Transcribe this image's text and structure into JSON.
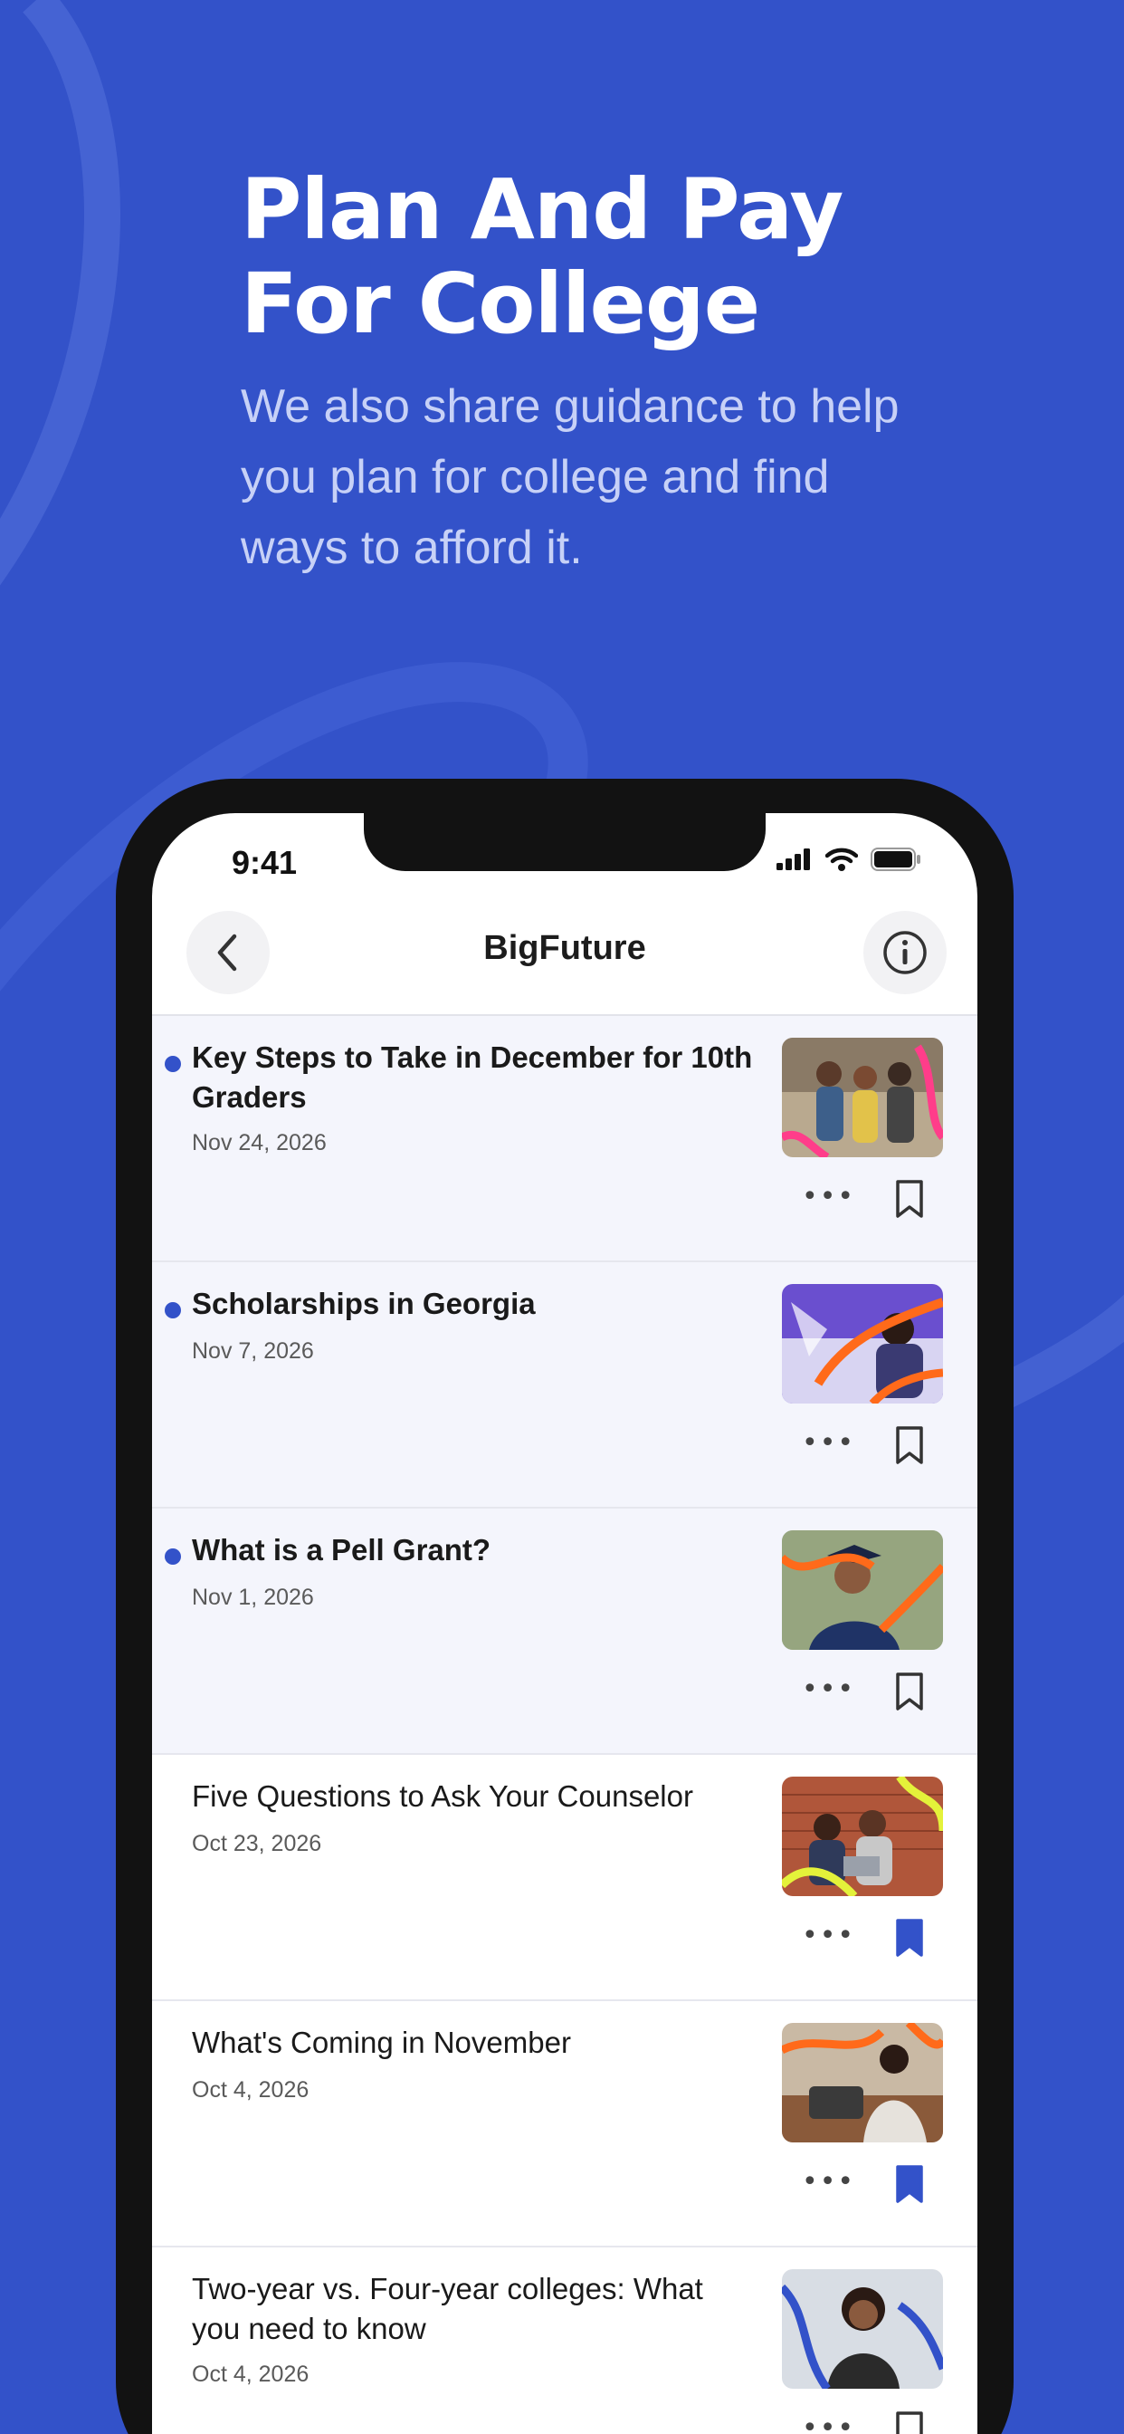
{
  "hero": {
    "title_line1": "Plan And Pay",
    "title_line2": "For College",
    "subtitle": "We also share guidance to help you plan for college and find ways to afford it."
  },
  "status_bar": {
    "time": "9:41",
    "icons": [
      "cellular-signal-icon",
      "wifi-icon",
      "battery-icon"
    ]
  },
  "nav": {
    "title": "BigFuture",
    "back_icon": "chevron-left-icon",
    "info_icon": "info-icon"
  },
  "colors": {
    "background": "#3352c9",
    "accent": "#3352c9",
    "unread_row": "#f4f5fc"
  },
  "articles": [
    {
      "title": "Key Steps to Take in December for 10th Graders",
      "date": "Nov 24, 2026",
      "unread": true,
      "bookmarked": false
    },
    {
      "title": "Scholarships in Georgia",
      "date": "Nov 7, 2026",
      "unread": true,
      "bookmarked": false
    },
    {
      "title": "What is a Pell Grant?",
      "date": "Nov 1, 2026",
      "unread": true,
      "bookmarked": false
    },
    {
      "title": "Five Questions to Ask Your Counselor",
      "date": "Oct 23, 2026",
      "unread": false,
      "bookmarked": true
    },
    {
      "title": "What's Coming in November",
      "date": "Oct 4, 2026",
      "unread": false,
      "bookmarked": true
    },
    {
      "title": "Two-year vs. Four-year colleges: What you need to know",
      "date": "Oct 4, 2026",
      "unread": false,
      "bookmarked": false
    }
  ],
  "item_actions": {
    "more_label": "•••",
    "more_icon": "more-horizontal-icon",
    "bookmark_icon": "bookmark-icon"
  }
}
